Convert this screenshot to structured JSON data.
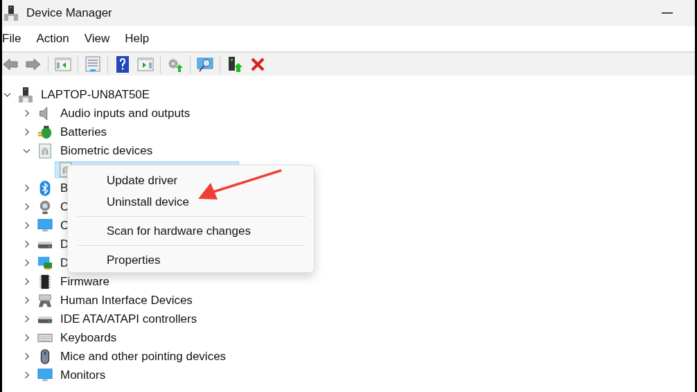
{
  "window": {
    "title": "Device Manager"
  },
  "menu_bar": [
    "File",
    "Action",
    "View",
    "Help"
  ],
  "tree": {
    "label": "LAPTOP-UN8AT50E",
    "kind": "computer",
    "expanded": true,
    "selected": false,
    "children": [
      {
        "label": "Audio inputs and outputs",
        "kind": "speaker",
        "expanded": false,
        "selected": false
      },
      {
        "label": "Batteries",
        "kind": "battery",
        "expanded": false,
        "selected": false
      },
      {
        "label": "Biometric devices",
        "kind": "fingerprint",
        "expanded": true,
        "selected": false,
        "children": [
          {
            "kind": "fingerprint",
            "selected": true
          }
        ]
      },
      {
        "label": "B",
        "kind": "bluetooth",
        "expanded": false,
        "selected": false
      },
      {
        "label": "C",
        "kind": "camera",
        "expanded": false,
        "selected": false
      },
      {
        "label": "C",
        "kind": "monitor",
        "expanded": false,
        "selected": false
      },
      {
        "label": "D",
        "kind": "drive",
        "expanded": false,
        "selected": false
      },
      {
        "label": "D",
        "kind": "display",
        "expanded": false,
        "selected": false
      },
      {
        "label": "Firmware",
        "kind": "chip",
        "expanded": false,
        "selected": false
      },
      {
        "label": "Human Interface Devices",
        "kind": "hid",
        "expanded": false,
        "selected": false
      },
      {
        "label": "IDE ATA/ATAPI controllers",
        "kind": "drive",
        "expanded": false,
        "selected": false
      },
      {
        "label": "Keyboards",
        "kind": "keyboard",
        "expanded": false,
        "selected": false
      },
      {
        "label": "Mice and other pointing devices",
        "kind": "mouse",
        "expanded": false,
        "selected": false
      },
      {
        "label": "Monitors",
        "kind": "monitor",
        "expanded": false,
        "selected": false
      }
    ]
  },
  "context_menu": {
    "groups": [
      [
        "Update driver",
        "Uninstall device"
      ],
      [
        "Scan for hardware changes"
      ],
      [
        "Properties"
      ]
    ]
  }
}
